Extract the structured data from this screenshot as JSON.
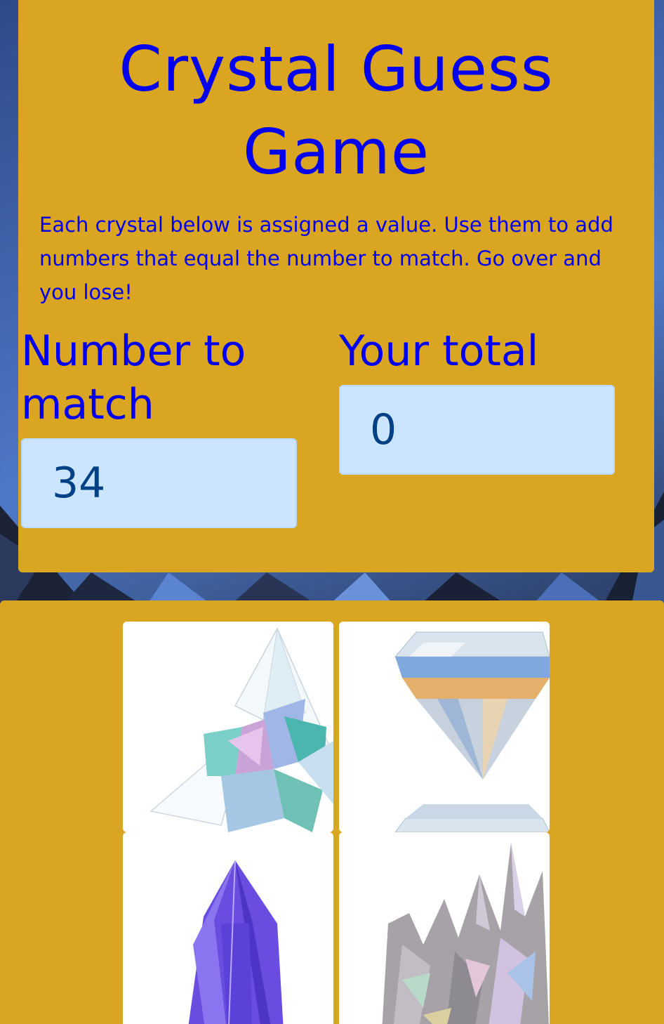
{
  "header": {
    "title": "Crystal Guess Game",
    "instructions": "Each crystal below is assigned a value. Use them to add numbers that equal the number to match. Go over and you lose!"
  },
  "stats": {
    "target_label": "Number to match",
    "target_value": "34",
    "total_label": "Your total",
    "total_value": "0"
  },
  "crystals": [
    {
      "icon": "white-crystal-cluster-icon"
    },
    {
      "icon": "diamond-icon"
    },
    {
      "icon": "purple-crystal-icon"
    },
    {
      "icon": "rainbow-crystal-cluster-icon"
    }
  ],
  "colors": {
    "panel": "#daa520",
    "heading": "#0000ee",
    "value_box": "#cce5ff",
    "value_text": "#004085"
  }
}
